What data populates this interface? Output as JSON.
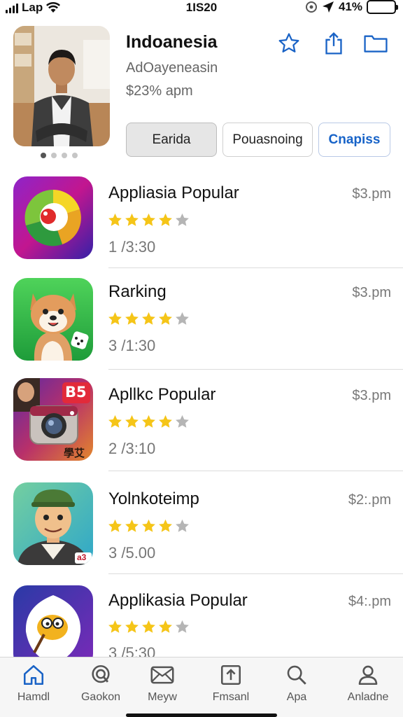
{
  "status_bar": {
    "carrier": "Lap",
    "time": "1IS20",
    "battery": "41%",
    "battery_level": 0.95
  },
  "header": {
    "title": "Indoanesia",
    "subtitle": "AdOayeneasin",
    "price": "$23% apm",
    "buttons": [
      "Earida",
      "Pouasnoing",
      "Cnapiss"
    ],
    "page_dots": 4,
    "active_dot": 0
  },
  "apps": [
    {
      "name": "Appliasia Popular",
      "price": "$3.pm",
      "rank": "1 /3:30",
      "rating": 4,
      "icon": "color-wheel-app-icon"
    },
    {
      "name": "Rarking",
      "price": "$3.pm",
      "rank": "3 /1:30",
      "rating": 4,
      "icon": "shiba-dog-app-icon"
    },
    {
      "name": "Apllkc Popular",
      "price": "$3.pm",
      "rank": "2 /3:10",
      "rating": 4,
      "icon": "camera-app-icon",
      "badge": "B5",
      "icon_text": "學艾"
    },
    {
      "name": "Yolnkoteimp",
      "price": "$2:.pm",
      "rank": "3 /5.00",
      "rating": 4,
      "icon": "cartoon-man-app-icon",
      "badge": "a3"
    },
    {
      "name": "Applikasia Popular",
      "price": "$4:.pm",
      "rank": "3 /5:30",
      "rating": 4,
      "icon": "mascot-app-icon"
    }
  ],
  "tabs": [
    {
      "label": "Hamdl",
      "icon": "home-icon",
      "active": true
    },
    {
      "label": "Gaokon",
      "icon": "search-circle-icon",
      "active": false
    },
    {
      "label": "Meyw",
      "icon": "mail-icon",
      "active": false
    },
    {
      "label": "Fmsanl",
      "icon": "upload-box-icon",
      "active": false
    },
    {
      "label": "Apa",
      "icon": "search-icon",
      "active": false
    },
    {
      "label": "Anladne",
      "icon": "person-icon",
      "active": false
    }
  ],
  "colors": {
    "accent": "#1a63c6",
    "star": "#f5c518",
    "star_off": "#b5b5b5",
    "battery": "#34c759"
  }
}
